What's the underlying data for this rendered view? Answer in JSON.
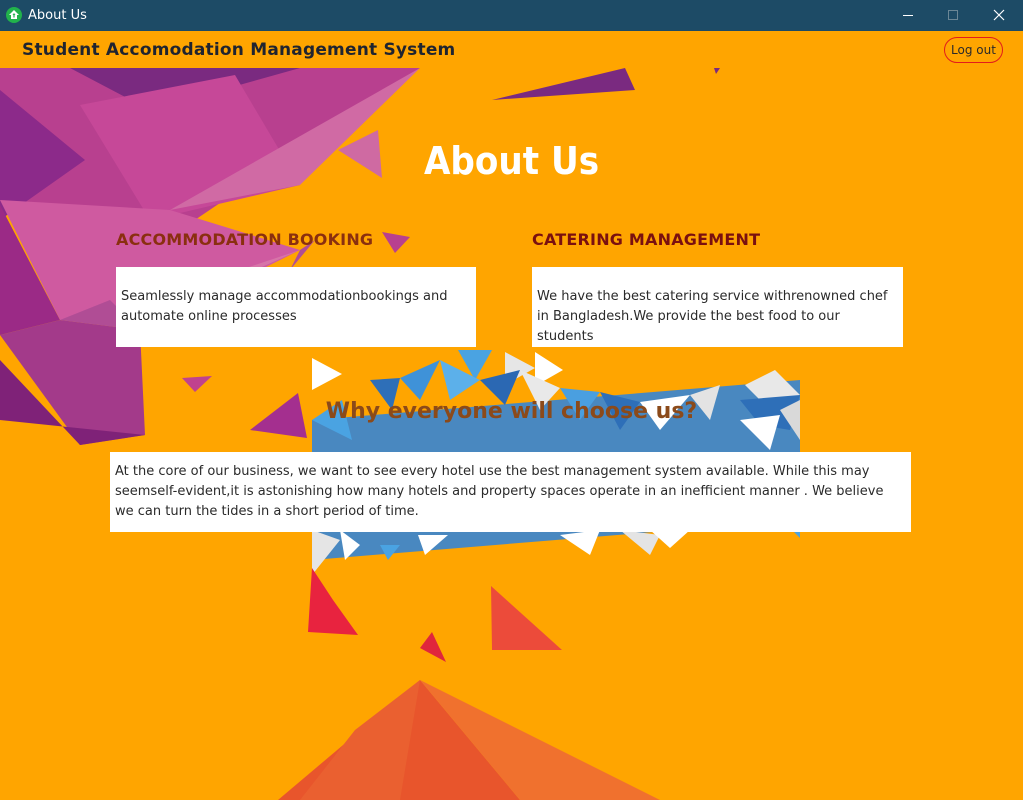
{
  "window": {
    "title": "About Us",
    "icon": "house-up-arrow-icon",
    "controls": [
      "minimize-icon",
      "maximize-icon",
      "close-icon"
    ]
  },
  "header": {
    "app_title": "Student Accomodation Management System",
    "logout_label": "Log out"
  },
  "page": {
    "heading": "About Us"
  },
  "sections": {
    "accommodation": {
      "title": "ACCOMMODATION BOOKING",
      "text": "Seamlessly manage accommodationbookings and automate online processes"
    },
    "catering": {
      "title": "CATERING MANAGEMENT",
      "text": "We have the best catering service withrenowned chef in Bangladesh.We provide the best food to our students"
    },
    "why": {
      "title": "Why everyone will choose us?",
      "text": "At the core of our business, we want to see every hotel use the best management system available. While this may seemself-evident,it is astonishing how many hotels and property spaces operate in an inefficient manner . We believe we can turn the tides in a short period of time."
    }
  },
  "colors": {
    "background": "#ffa500",
    "titlebar": "#1d4b66",
    "logout_border": "#e21c1c",
    "heading_accom": "#8a2f0f",
    "heading_cater": "#7a1010",
    "heading_why": "#8b4a1a"
  }
}
